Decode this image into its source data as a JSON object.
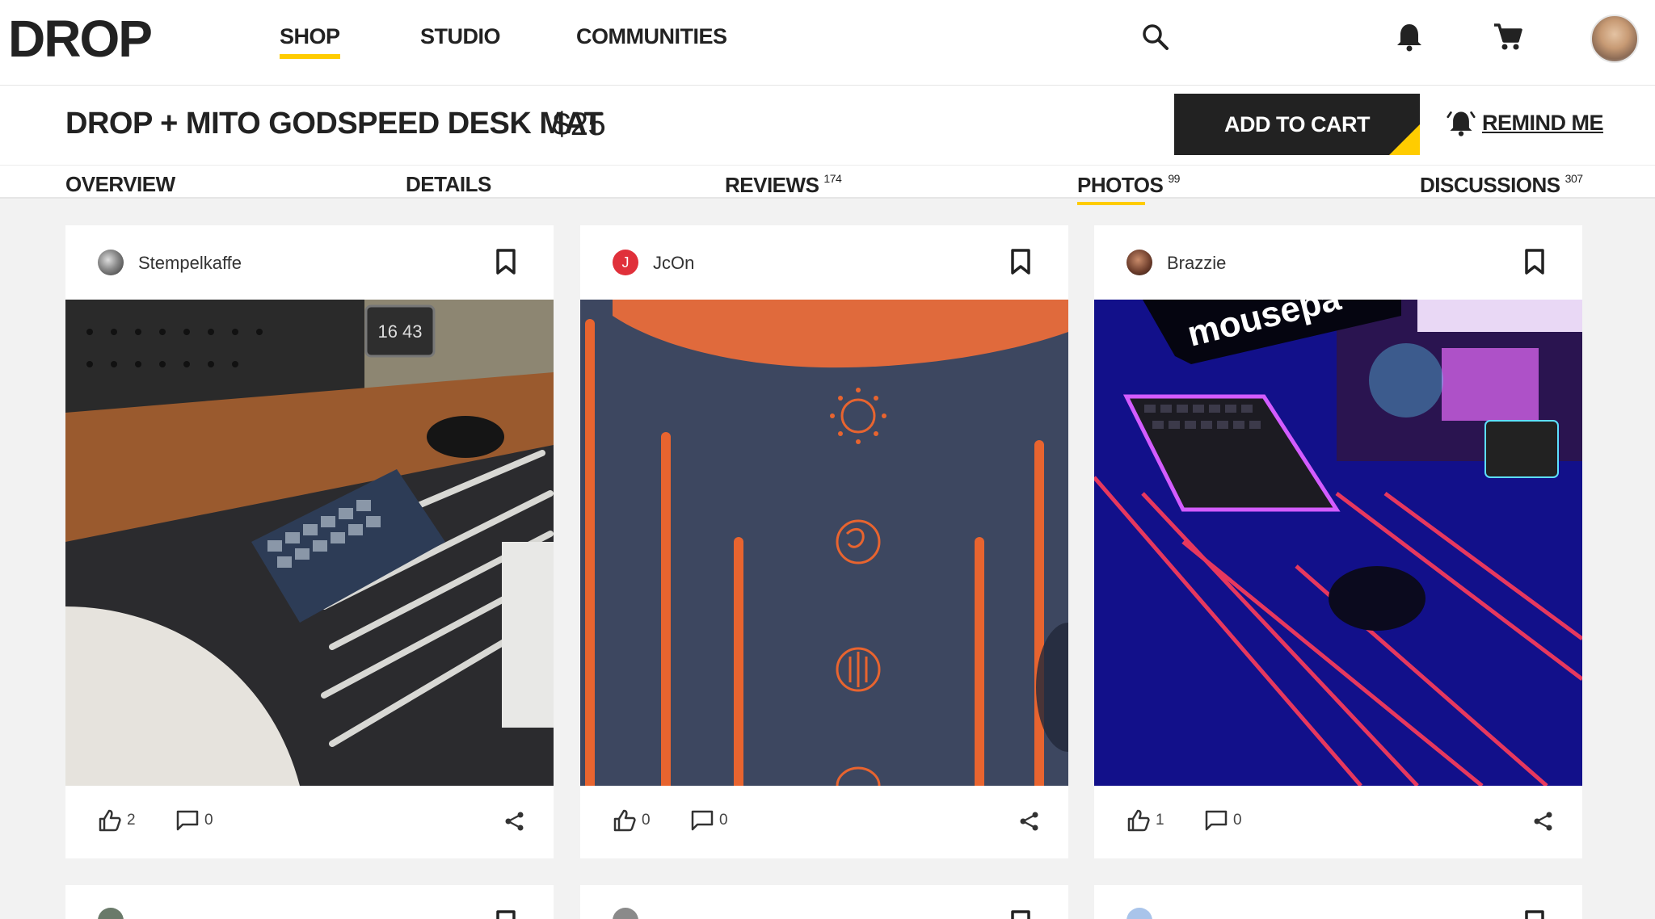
{
  "brand": {
    "logo_text": "DROP",
    "accent": "#ffcc00",
    "dark": "#222222"
  },
  "topnav": {
    "links": [
      "SHOP",
      "STUDIO",
      "COMMUNITIES"
    ],
    "active": "SHOP",
    "icons": [
      "search-icon",
      "bell-icon",
      "cart-icon",
      "avatar"
    ]
  },
  "product": {
    "title": "DROP + MITO GODSPEED DESK MAT",
    "price": "$25",
    "add_to_cart": "ADD TO CART",
    "remind_me": "REMIND ME"
  },
  "tabs": [
    {
      "label": "OVERVIEW",
      "count": ""
    },
    {
      "label": "DETAILS",
      "count": ""
    },
    {
      "label": "REVIEWS",
      "count": "174"
    },
    {
      "label": "PHOTOS",
      "count": "99"
    },
    {
      "label": "DISCUSSIONS",
      "count": "307"
    }
  ],
  "active_tab": "PHOTOS",
  "cards": [
    {
      "user": "Stempelkaffe",
      "avatar_color": "#6b6b6b",
      "likes": "2",
      "comments": "0",
      "photo_clock": "16 43"
    },
    {
      "user": "JcOn",
      "avatar_color": "#e0303a",
      "avatar_letter": "J",
      "likes": "0",
      "comments": "0"
    },
    {
      "user": "Brazzie",
      "avatar_color": "#8a5a4a",
      "likes": "1",
      "comments": "0",
      "photo_caption": "mousepa"
    }
  ]
}
